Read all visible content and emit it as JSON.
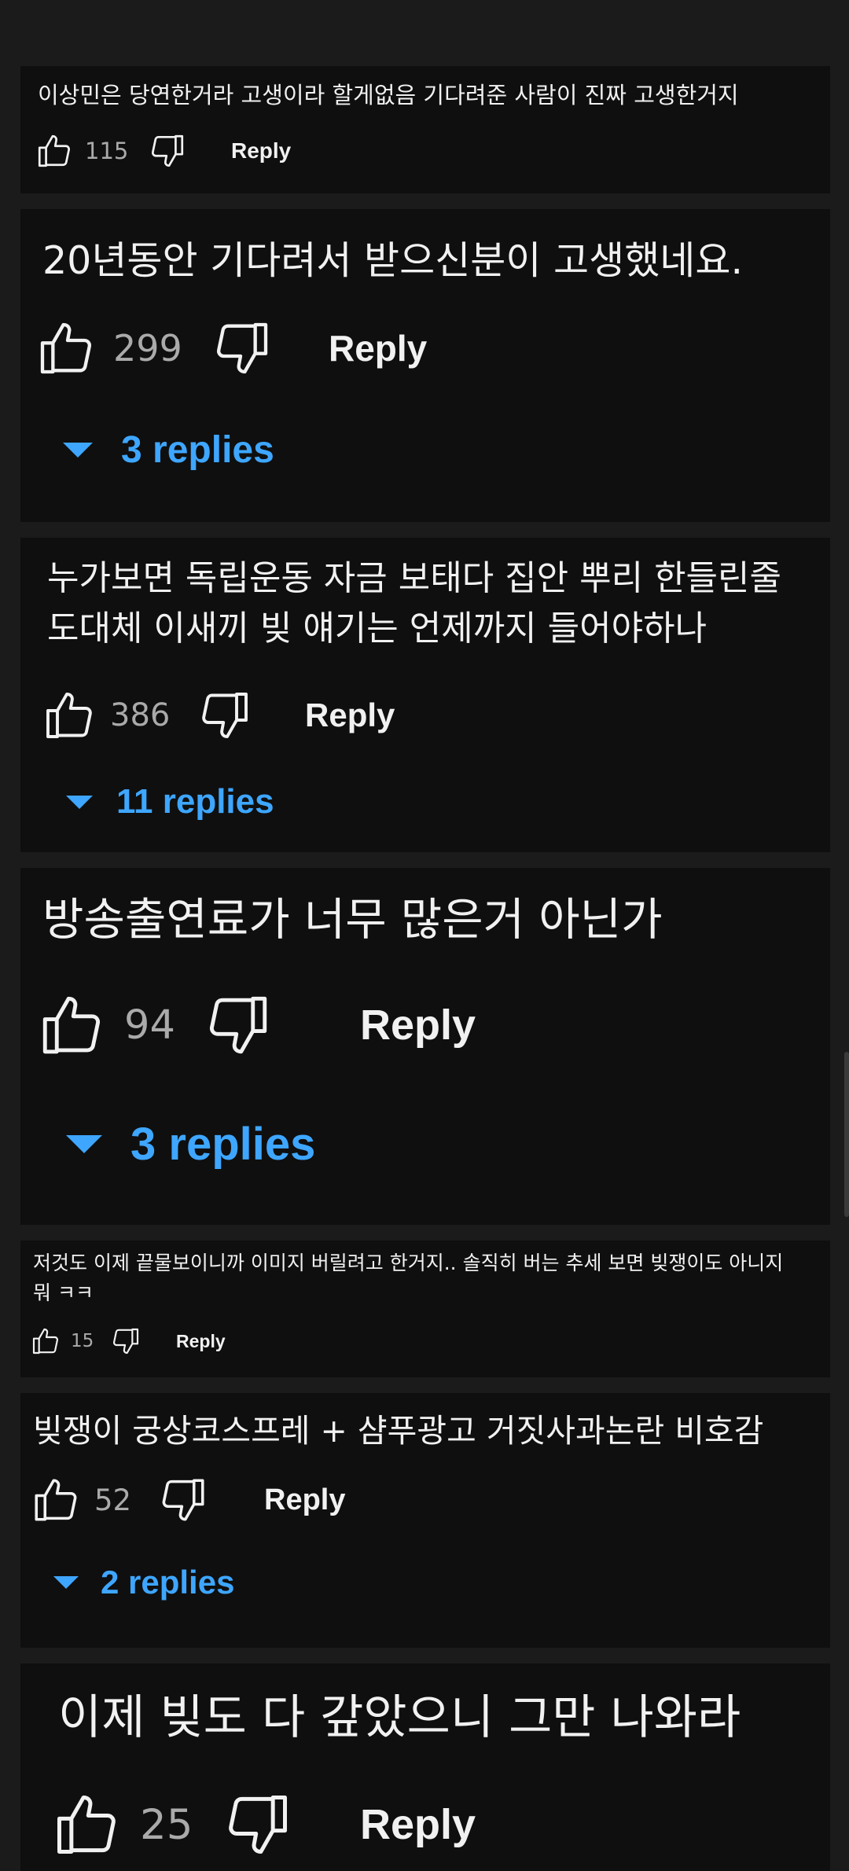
{
  "colors": {
    "background": "#1b1b1b",
    "card": "#0f0f0f",
    "text": "#f1f1f1",
    "count": "#aaaaaa",
    "accent": "#3ea6ff"
  },
  "icons": {
    "like": "thumbs-up-icon",
    "dislike": "thumbs-down-icon",
    "expand": "caret-down-icon"
  },
  "comments": [
    {
      "text": "이상민은 당연한거라 고생이라 할게없음 기다려준 사람이 진짜 고생한거지",
      "likes": "115",
      "reply_label": "Reply",
      "replies_label": ""
    },
    {
      "text": "20년동안 기다려서 받으신분이 고생했네요.",
      "likes": "299",
      "reply_label": "Reply",
      "replies_label": "3 replies"
    },
    {
      "text": "누가보면 독립운동 자금 보태다 집안 뿌리 한들린줄\n도대체 이새끼 빚 얘기는 언제까지 들어야하나",
      "likes": "386",
      "reply_label": "Reply",
      "replies_label": "11 replies"
    },
    {
      "text": "방송출연료가 너무 많은거 아닌가",
      "likes": "94",
      "reply_label": "Reply",
      "replies_label": "3 replies"
    },
    {
      "text": "저것도 이제 끝물보이니까 이미지 버릴려고 한거지.. 솔직히 버는 추세 보면 빚쟁이도 아니지\n뭐 ㅋㅋ",
      "likes": "15",
      "reply_label": "Reply",
      "replies_label": ""
    },
    {
      "text": "빚쟁이 궁상코스프레 + 샴푸광고 거짓사과논란 비호감",
      "likes": "52",
      "reply_label": "Reply",
      "replies_label": "2 replies"
    },
    {
      "text": "이제 빚도 다 갚았으니 그만 나와라",
      "likes": "25",
      "reply_label": "Reply",
      "replies_label": ""
    }
  ]
}
